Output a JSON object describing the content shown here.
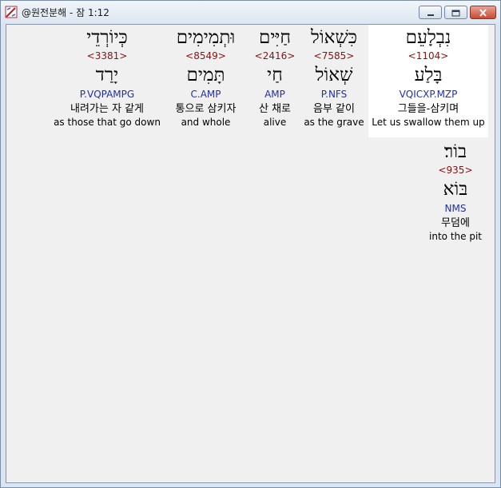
{
  "window": {
    "title": "@원전분해 - 잠 1:12"
  },
  "controls": {
    "minimize_icon": "minimize-icon",
    "maximize_icon": "maximize-icon",
    "close_icon": "close-icon"
  },
  "words": [
    {
      "hebrew": "נִבְלָעֵם",
      "strong": "<1104>",
      "lemma": "בָּלַע",
      "parse": "VQICXP.MZP",
      "korean": "그들을-삼키며",
      "english": "Let us swallow them up",
      "selected": true
    },
    {
      "hebrew": "כִּשְׁאוֹל",
      "strong": "<7585>",
      "lemma": "שְׁאוֹל",
      "parse": "P.NFS",
      "korean": "음부 같이",
      "english": "as the grave",
      "selected": false
    },
    {
      "hebrew": "חַיִּים",
      "strong": "<2416>",
      "lemma": "חַי",
      "parse": "AMP",
      "korean": "산 채로",
      "english": "alive",
      "selected": false
    },
    {
      "hebrew": "וּתְמִימִים",
      "strong": "<8549>",
      "lemma": "תָּמִים",
      "parse": "C.AMP",
      "korean": "통으로 삼키자",
      "english": "and whole",
      "selected": false
    },
    {
      "hebrew": "כְּיוֹרְדֵי",
      "strong": "<3381>",
      "lemma": "יָרַד",
      "parse": "P.VQPAMPG",
      "korean": "내려가는 자 같게",
      "english": "as those that go down",
      "selected": false
    },
    {
      "hebrew": "בוֹר׃",
      "strong": "<935>",
      "lemma": "בּוֹא",
      "parse": "NMS",
      "korean": "무덤에",
      "english": "into the pit",
      "selected": false
    }
  ]
}
